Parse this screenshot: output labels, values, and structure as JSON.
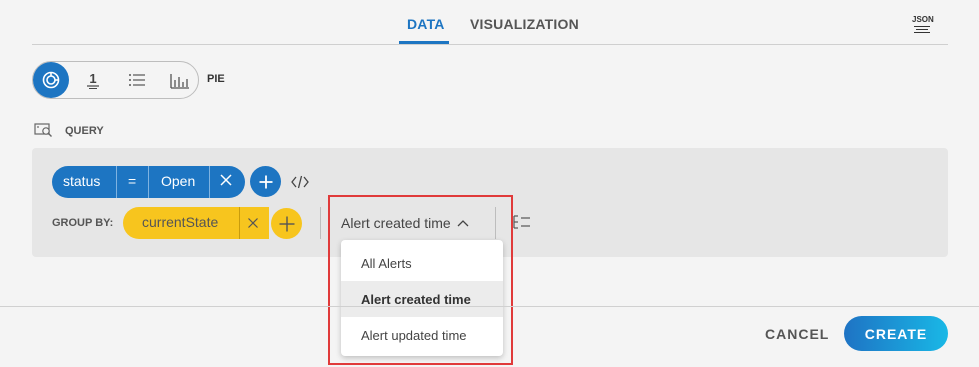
{
  "tabs": [
    {
      "label": "DATA",
      "active": true
    },
    {
      "label": "VISUALIZATION",
      "active": false
    }
  ],
  "json_icon_label": "JSON",
  "viz_types": [
    {
      "icon": "pie-chart-icon",
      "active": true
    },
    {
      "icon": "single-value-icon",
      "text": "1"
    },
    {
      "icon": "list-icon"
    },
    {
      "icon": "bar-chart-icon"
    }
  ],
  "viz_selected_label": "PIE",
  "query": {
    "label": "QUERY",
    "filter": {
      "field": "status",
      "operator": "=",
      "value": "Open"
    },
    "group_by_label": "GROUP BY:",
    "group_by_field": "currentState",
    "time_dropdown_label": "Alert created time"
  },
  "time_menu": {
    "items": [
      "All Alerts",
      "Alert created time",
      "Alert updated time"
    ],
    "selected_index": 1
  },
  "footer": {
    "cancel_label": "CANCEL",
    "create_label": "CREATE"
  },
  "colors": {
    "accent": "#1d75c2",
    "group_chip": "#f7c51e",
    "highlight": "#e03a3a"
  }
}
